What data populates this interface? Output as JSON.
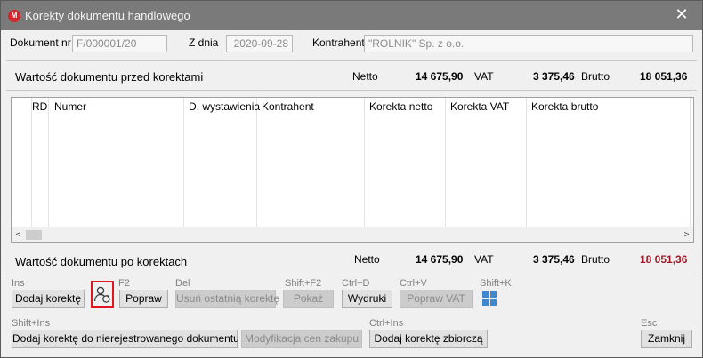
{
  "window": {
    "title": "Korekty dokumentu handlowego",
    "app_icon": "M",
    "close_glyph": "✕"
  },
  "header": {
    "doc_nr_label": "Dokument nr",
    "doc_nr_value": "F/000001/20",
    "date_label": "Z dnia",
    "date_value": "2020-09-28",
    "contractor_label": "Kontrahent",
    "contractor_value": "\"ROLNIK\" Sp. z o.o."
  },
  "before": {
    "title": "Wartość dokumentu przed korektami",
    "netto_label": "Netto",
    "netto_value": "14 675,90",
    "vat_label": "VAT",
    "vat_value": "3 375,46",
    "brutto_label": "Brutto",
    "brutto_value": "18 051,36"
  },
  "grid": {
    "columns": [
      "RD",
      "Numer",
      "D. wystawienia",
      "Kontrahent",
      "Korekta netto",
      "Korekta VAT",
      "Korekta brutto"
    ],
    "rows": [],
    "scroll_left": "<",
    "scroll_right": ">"
  },
  "after": {
    "title": "Wartość dokumentu po korektach",
    "netto_label": "Netto",
    "netto_value": "14 675,90",
    "vat_label": "VAT",
    "vat_value": "3 375,46",
    "brutto_label": "Brutto",
    "brutto_value": "18 051,36",
    "brutto_color": "#9b1b2b"
  },
  "actions": {
    "add_correction": {
      "shortcut": "Ins",
      "label": "Dodaj korektę"
    },
    "correct": {
      "shortcut": "F2",
      "label": "Popraw"
    },
    "delete_last": {
      "shortcut": "Del",
      "label": "Usuń ostatnią korektę"
    },
    "show": {
      "shortcut": "Shift+F2",
      "label": "Pokaż"
    },
    "prints": {
      "shortcut": "Ctrl+D",
      "label": "Wydruki"
    },
    "fix_vat": {
      "shortcut": "Ctrl+V",
      "label": "Popraw VAT"
    },
    "grid_view": {
      "shortcut": "Shift+K"
    },
    "add_unregistered": {
      "shortcut": "Shift+Ins",
      "label": "Dodaj korektę do nierejestrowanego dokumentu"
    },
    "modify_prices": {
      "label": "Modyfikacja cen zakupu"
    },
    "add_collective": {
      "shortcut": "Ctrl+Ins",
      "label": "Dodaj korektę zbiorczą"
    },
    "close": {
      "shortcut": "Esc",
      "label": "Zamknij"
    }
  },
  "colors": {
    "accent_red": "#e0161c",
    "titlebar": "#7a7a7a",
    "grid_icon": "#3f88cf"
  }
}
